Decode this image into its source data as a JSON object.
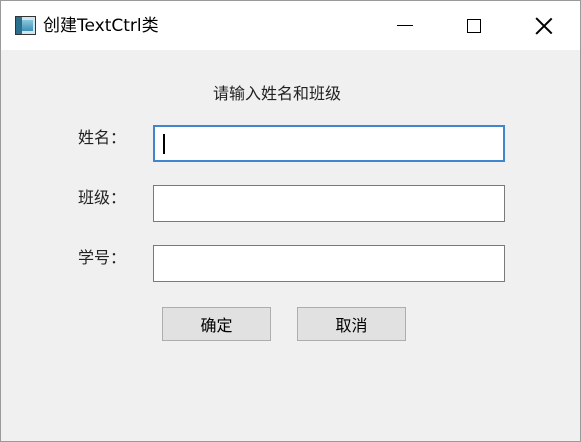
{
  "window": {
    "title": "创建TextCtrl类",
    "app_icon": "window-app-icon",
    "controls": {
      "minimize_icon": "minimize-icon",
      "maximize_icon": "maximize-icon",
      "close_icon": "close-icon"
    }
  },
  "form": {
    "heading": "请输入姓名和班级",
    "fields": [
      {
        "label": "姓名：",
        "value": "",
        "focused": true
      },
      {
        "label": "班级：",
        "value": "",
        "focused": false
      },
      {
        "label": "学号：",
        "value": "",
        "focused": false
      }
    ],
    "ok_label": "确定",
    "cancel_label": "取消"
  },
  "colors": {
    "focus_border": "#3f86cf",
    "dialog_background": "#f0f0f0"
  }
}
